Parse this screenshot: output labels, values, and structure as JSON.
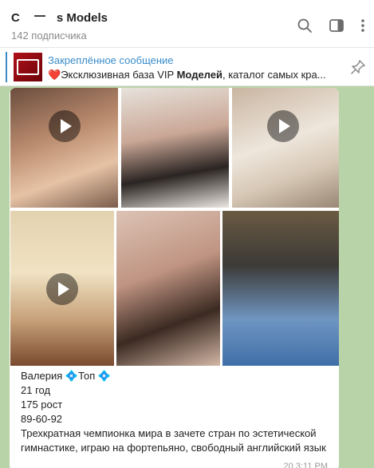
{
  "header": {
    "title_prefix": "C",
    "title_suffix": "s Models",
    "subtitle": "142 подписчика"
  },
  "pinned": {
    "label": "Закреплённое сообщение",
    "heart": "❤️",
    "text_start": "Эксклюзивная база VIP ",
    "text_bold": "Моделей",
    "text_end": ", каталог самых кра..."
  },
  "message": {
    "name": "Валерия",
    "diamond": "💠",
    "tag": "Топ",
    "age": "21 год",
    "height": "175 рост",
    "measurements": "89-60-92",
    "bio": "Трехкратная чемпионка мира в зачете стран по эстетической гимнастике, играю на фортепьяно, свободный английский язык",
    "meta": "20   3:11 PM"
  },
  "icons": {
    "search": "search-icon",
    "sidebar": "sidebar-toggle-icon",
    "more": "more-vertical-icon",
    "pin": "pin-icon",
    "play": "play-icon"
  },
  "colors": {
    "accent": "#3a8cc9",
    "background": "#b9d3a8"
  }
}
